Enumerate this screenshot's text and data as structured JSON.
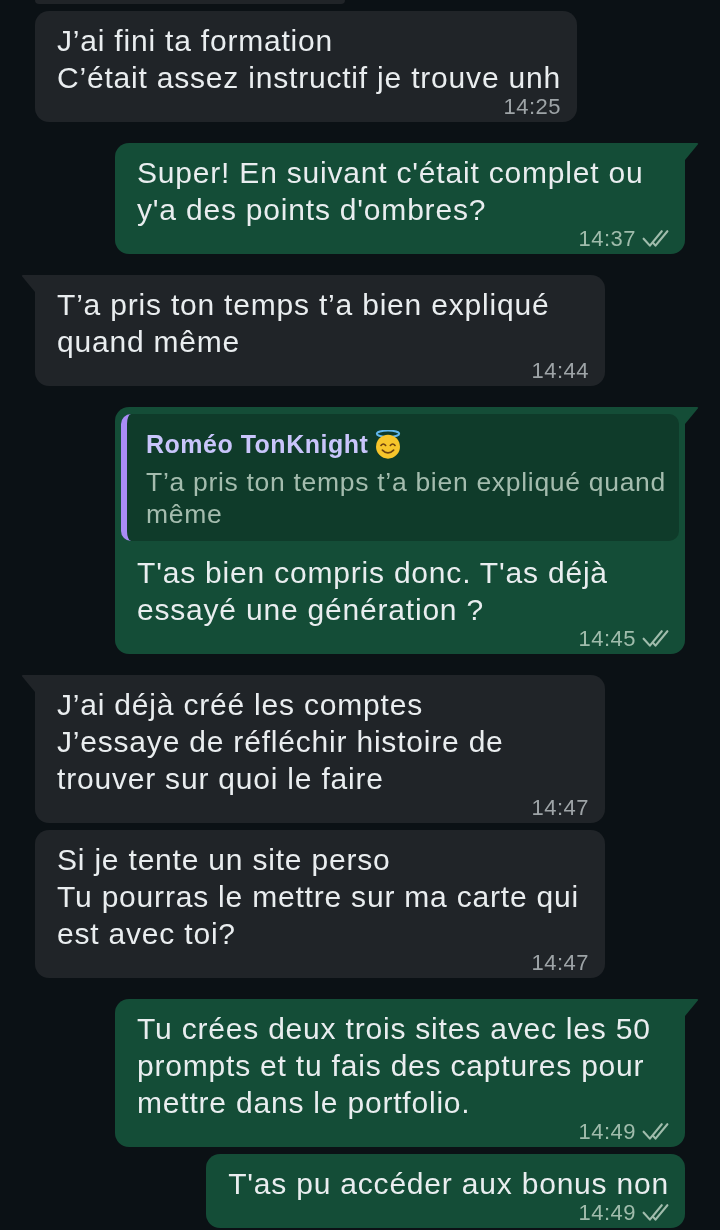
{
  "messages": [
    {
      "outgoing": false,
      "tail": false,
      "text": "J’ai fini ta formation\nC’était assez instructif je trouve unh",
      "time": "14:25"
    },
    {
      "outgoing": true,
      "tail": true,
      "text": "Super! En suivant c'était complet ou y'a des points d'ombres?",
      "time": "14:37",
      "read": false
    },
    {
      "outgoing": false,
      "tail": true,
      "text": "T’a pris ton temps t’a bien expliqué quand même",
      "time": "14:44"
    },
    {
      "outgoing": true,
      "tail": true,
      "reply_to": {
        "author": "Roméo TonKnight",
        "text": "T’a pris ton temps t’a bien expliqué quand même"
      },
      "text": "T'as bien compris donc. T'as déjà essayé une génération ?",
      "time": "14:45",
      "read": false
    },
    {
      "outgoing": false,
      "tail": true,
      "text": "J’ai déjà créé les comptes\nJ’essaye de réfléchir histoire de trouver sur quoi le faire",
      "time": "14:47"
    },
    {
      "outgoing": false,
      "tail": false,
      "text": "Si je tente un site perso\nTu pourras le mettre sur ma carte qui est avec toi?",
      "time": "14:47"
    },
    {
      "outgoing": true,
      "tail": true,
      "text": "Tu crées deux trois sites avec les 50 prompts et tu fais des captures pour mettre dans le portfolio.",
      "time": "14:49",
      "read": false
    },
    {
      "outgoing": true,
      "tail": false,
      "text": "T'as pu accéder aux bonus non",
      "time": "14:49",
      "read": false
    }
  ]
}
